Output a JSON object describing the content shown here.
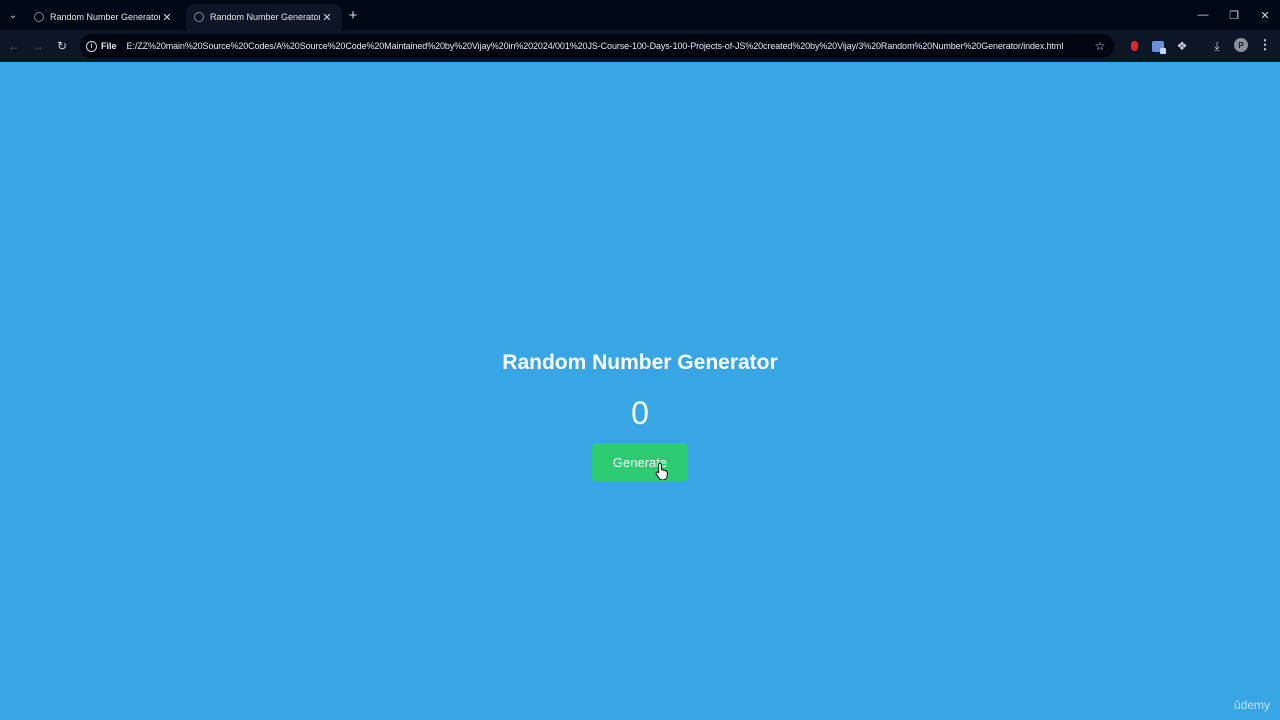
{
  "browser": {
    "tabs": [
      {
        "title": "Random Number Generator",
        "active": false
      },
      {
        "title": "Random Number Generator",
        "active": true
      }
    ],
    "address": {
      "chip_label": "File",
      "url": "E:/ZZ%20main%20Source%20Codes/A%20Source%20Code%20Maintained%20by%20Vijay%20in%202024/001%20JS-Course-100-Days-100-Projects-of-JS%20created%20by%20Vijay/3%20Random%20Number%20Generator/index.html"
    },
    "profile_initial": "P"
  },
  "app": {
    "title": "Random Number Generator",
    "number": "0",
    "button_label": "Generate",
    "button_color": "#2dcb72",
    "background_color": "#38a5e5"
  },
  "watermark": "ûdemy"
}
